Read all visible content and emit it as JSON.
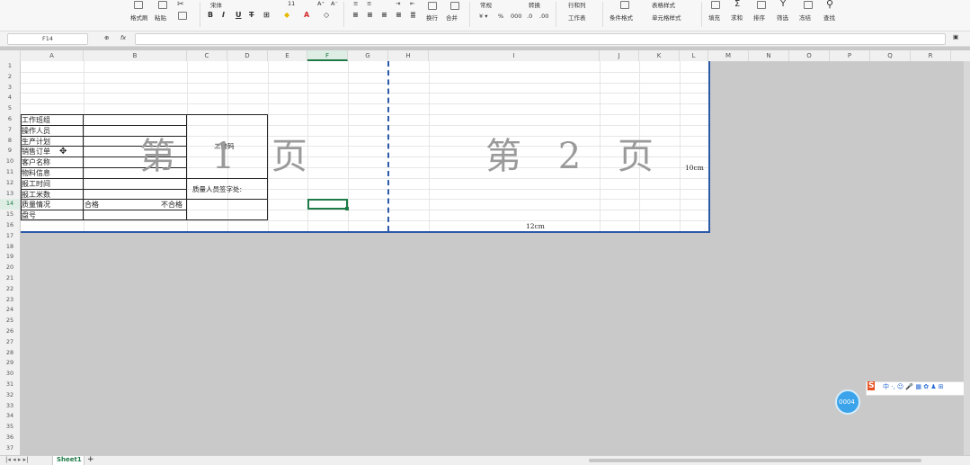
{
  "ribbon": {
    "groups": [
      {
        "label": "格式刷"
      },
      {
        "label": "粘贴"
      },
      {
        "label": "宋体"
      },
      {
        "label": "11"
      },
      {
        "label": "常规"
      },
      {
        "label": "转换"
      },
      {
        "label": "行和列"
      },
      {
        "label": "表格样式"
      },
      {
        "label": "工作表"
      },
      {
        "label": "条件格式"
      },
      {
        "label": "单元格样式"
      },
      {
        "label": "填充"
      },
      {
        "label": "求和"
      },
      {
        "label": "排序"
      },
      {
        "label": "筛选"
      },
      {
        "label": "冻结"
      },
      {
        "label": "查找"
      },
      {
        "label": "换行"
      },
      {
        "label": "合并"
      }
    ]
  },
  "formula_bar": {
    "name_box": "F14",
    "fx": "fx"
  },
  "columns": [
    "A",
    "B",
    "C",
    "D",
    "E",
    "F",
    "G",
    "H",
    "I",
    "J",
    "K",
    "L",
    "M",
    "N",
    "O",
    "P",
    "Q",
    "R"
  ],
  "rows": [
    "1",
    "2",
    "3",
    "4",
    "5",
    "6",
    "7",
    "8",
    "9",
    "10",
    "11",
    "12",
    "13",
    "14",
    "15",
    "16",
    "17",
    "18",
    "19",
    "20",
    "21",
    "22",
    "23",
    "24",
    "25",
    "26",
    "27",
    "28",
    "29",
    "30",
    "31",
    "32",
    "33",
    "34",
    "35",
    "36",
    "37"
  ],
  "sheet": {
    "labels": [
      "工作班组",
      "操作人员",
      "生产计划",
      "销售订单",
      "客户名称",
      "物料信息",
      "报工时间",
      "报工米数",
      "质量情况",
      "盘号"
    ],
    "qrcode_label": "二维码",
    "signature_label": "质量人员签字处:",
    "quality_ok": "合格",
    "quality_ng": "不合格",
    "page1_watermark": "第 1 页",
    "page2_watermark": "第 2 页",
    "width_note": "12cm",
    "height_note": "10cm"
  },
  "tabs": {
    "sheet1": "Sheet1",
    "add": "+"
  },
  "floating": {
    "badge": "0004"
  }
}
